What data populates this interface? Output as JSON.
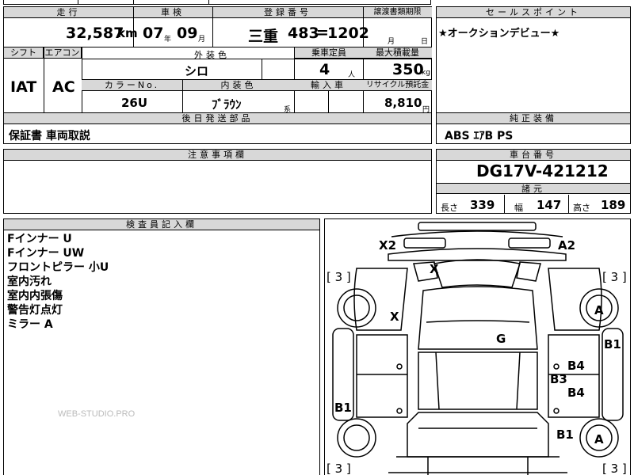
{
  "headers": {
    "mileage": "走行",
    "inspection": "車検",
    "registration": "登録番号",
    "transfer_deadline": "譲渡書類期限",
    "sales_point": "セールスポイント",
    "shift": "シフト",
    "aircon": "エアコン",
    "exterior_color": "外装色",
    "capacity": "乗車定員",
    "max_load": "最大積載量",
    "color_no": "カラーNo.",
    "interior_color": "内装色",
    "import": "輸入車",
    "recycle": "リサイクル預託金",
    "later_items": "後日発送部品",
    "equipment": "純正装備",
    "caution": "注意事項欄",
    "chassis": "車台番号",
    "specs": "諸元",
    "inspector": "検査員記入欄"
  },
  "values": {
    "mileage": "32,587",
    "mileage_unit": "km",
    "insp_year": "07",
    "insp_year_unit": "年",
    "insp_month": "09",
    "insp_month_unit": "月",
    "plate_region": "三重",
    "plate_number": "483",
    "plate_sep": "=",
    "plate_id": "1202",
    "deadline_month_unit": "月",
    "deadline_day_unit": "日",
    "sales_point": "★オークションデビュー★",
    "shift": "IAT",
    "aircon": "AC",
    "exterior_color": "シロ",
    "capacity": "4",
    "capacity_unit": "人",
    "max_load": "350",
    "max_load_unit": "kg",
    "color_no": "26U",
    "interior_color": "ﾌﾞﾗｳﾝ",
    "interior_suffix": "系",
    "recycle": "8,810",
    "recycle_unit": "円",
    "later_items": "保証書 車両取説",
    "equipment": "ABS ｴｱB PS",
    "chassis": "DG17V-421212",
    "length_label": "長さ",
    "length": "339",
    "width_label": "幅",
    "width": "147",
    "height_label": "高さ",
    "height": "189"
  },
  "inspector_notes": [
    "Fインナー U",
    "Fインナー UW",
    "フロントピラー 小U",
    "室内汚れ",
    "室内内張傷",
    "警告灯点灯",
    "ミラー A"
  ],
  "watermark": "WEB-STUDIO.PRO",
  "diagram_marks": {
    "x2": "X2",
    "a2": "A2",
    "x_windshield": "X",
    "x_left": "X",
    "g": "G",
    "a_front_right": "A",
    "b1_right": "B1",
    "b4_upper": "B4",
    "b3": "B3",
    "b4_lower": "B4",
    "b1_left": "B1",
    "b1_rear_right": "B1",
    "a_rear_right": "A",
    "tire_fl": "[ 3 ]",
    "tire_fr": "[ 3 ]",
    "tire_rl": "[ 3 ]",
    "tire_rr": "[ 3 ]"
  }
}
